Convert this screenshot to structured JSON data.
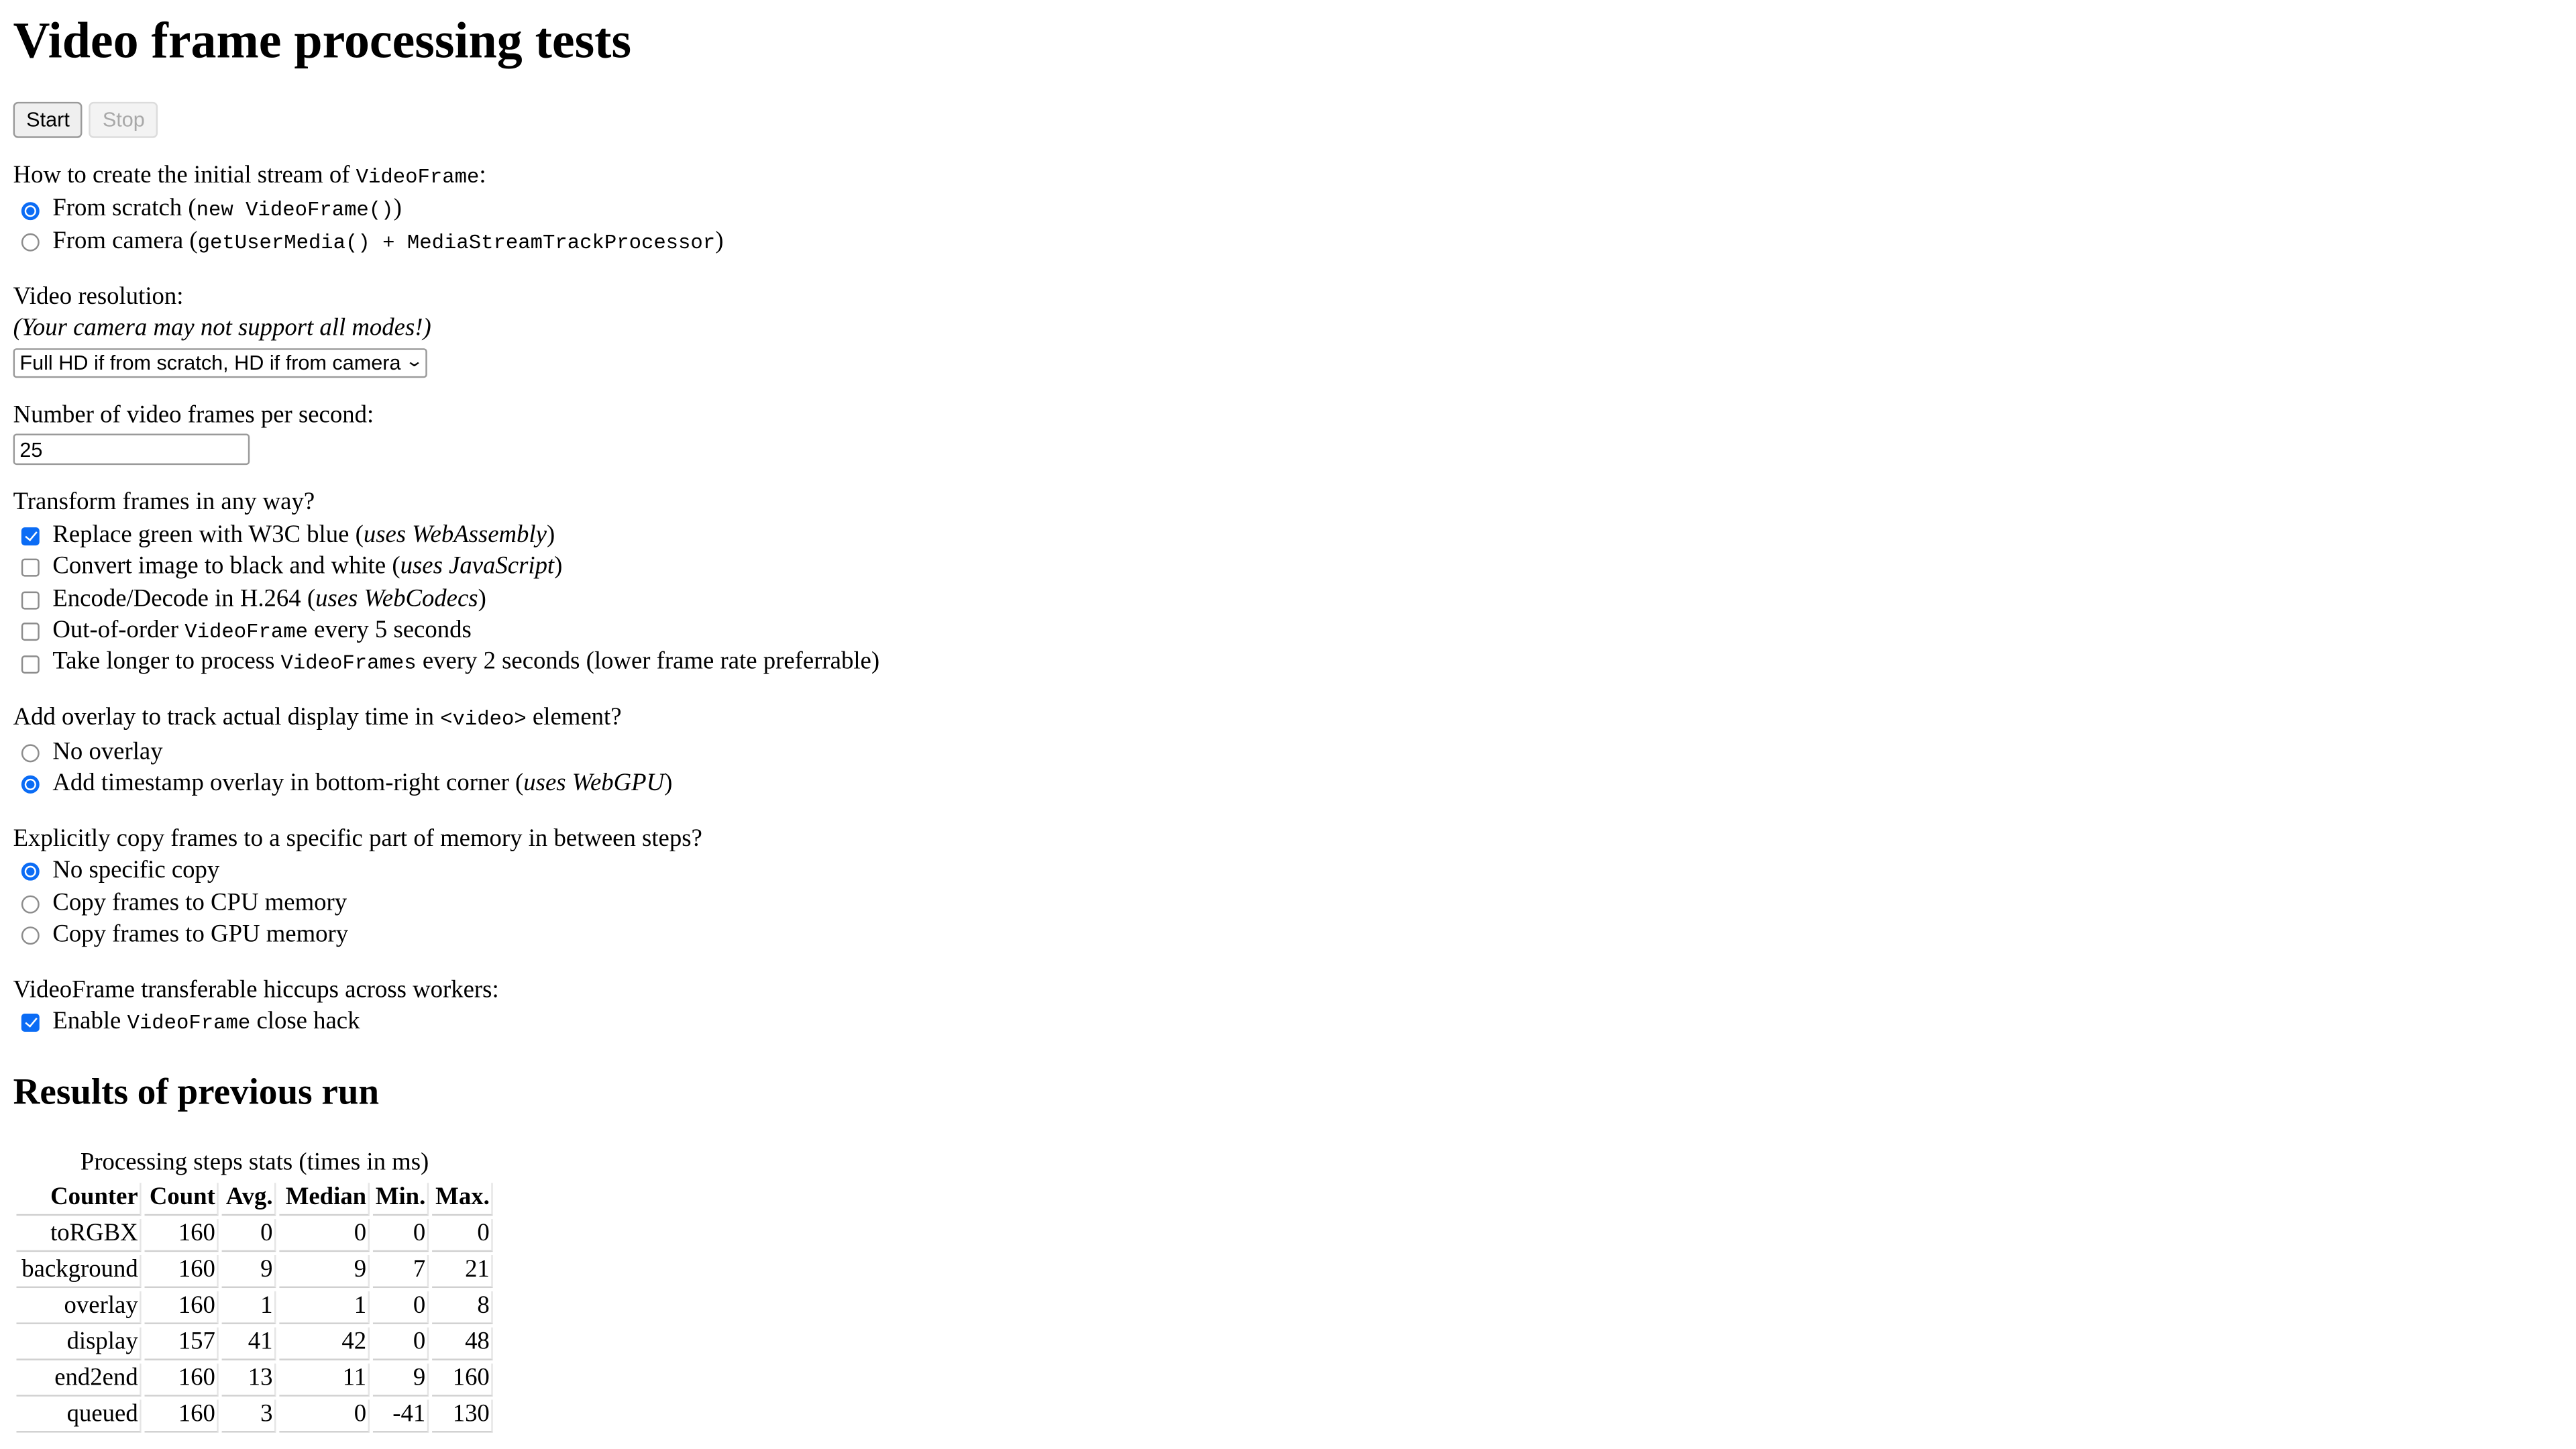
{
  "page": {
    "title": "Video frame processing tests"
  },
  "toolbar": {
    "start_label": "Start",
    "stop_label": "Stop"
  },
  "source": {
    "label_prefix": "How to create the initial stream of ",
    "label_code": "VideoFrame",
    "label_suffix": ":",
    "options": [
      {
        "text": "From scratch (",
        "code": "new VideoFrame()",
        "after": ")",
        "checked": true
      },
      {
        "text": "From camera (",
        "code": "getUserMedia() + MediaStreamTrackProcessor",
        "after": ")",
        "checked": false
      }
    ]
  },
  "resolution": {
    "label": "Video resolution:",
    "note": "(Your camera may not support all modes!)",
    "selected": "Full HD if from scratch, HD if from camera"
  },
  "fps": {
    "label": "Number of video frames per second:",
    "value": "25"
  },
  "transform": {
    "label": "Transform frames in any way?",
    "options": [
      {
        "before": "Replace green with W3C blue (",
        "italic": "uses WebAssembly",
        "after": ")",
        "checked": true
      },
      {
        "before": "Convert image to black and white (",
        "italic": "uses JavaScript",
        "after": ")",
        "checked": false
      },
      {
        "before": "Encode/Decode in H.264 (",
        "italic": "uses WebCodecs",
        "after": ")",
        "checked": false
      },
      {
        "before": "Out-of-order ",
        "code": "VideoFrame",
        "after": " every 5 seconds",
        "checked": false
      },
      {
        "before": "Take longer to process ",
        "code": "VideoFrames",
        "after": " every 2 seconds (lower frame rate preferrable)",
        "checked": false
      }
    ]
  },
  "overlay": {
    "label_prefix": "Add overlay to track actual display time in ",
    "label_code": "<video>",
    "label_suffix": " element?",
    "options": [
      {
        "before": "No overlay",
        "checked": false
      },
      {
        "before": "Add timestamp overlay in bottom-right corner (",
        "italic": "uses WebGPU",
        "after": ")",
        "checked": true
      }
    ]
  },
  "memory": {
    "label": "Explicitly copy frames to a specific part of memory in between steps?",
    "options": [
      {
        "label": "No specific copy",
        "checked": true
      },
      {
        "label": "Copy frames to CPU memory",
        "checked": false
      },
      {
        "label": "Copy frames to GPU memory",
        "checked": false
      }
    ]
  },
  "hiccups": {
    "label": "VideoFrame transferable hiccups across workers:",
    "option": {
      "before": "Enable ",
      "code": "VideoFrame",
      "after": " close hack",
      "checked": true
    }
  },
  "results": {
    "title": "Results of previous run",
    "caption": "Processing steps stats (times in ms)",
    "columns": [
      "Counter",
      "Count",
      "Avg.",
      "Median",
      "Min.",
      "Max."
    ],
    "rows": [
      [
        "toRGBX",
        "160",
        "0",
        "0",
        "0",
        "0"
      ],
      [
        "background",
        "160",
        "9",
        "9",
        "7",
        "21"
      ],
      [
        "overlay",
        "160",
        "1",
        "1",
        "0",
        "8"
      ],
      [
        "display",
        "157",
        "41",
        "42",
        "0",
        "48"
      ],
      [
        "end2end",
        "160",
        "13",
        "11",
        "9",
        "160"
      ],
      [
        "queued",
        "160",
        "3",
        "0",
        "-41",
        "130"
      ]
    ]
  },
  "colors": {
    "accent": "#0b6cf5"
  }
}
